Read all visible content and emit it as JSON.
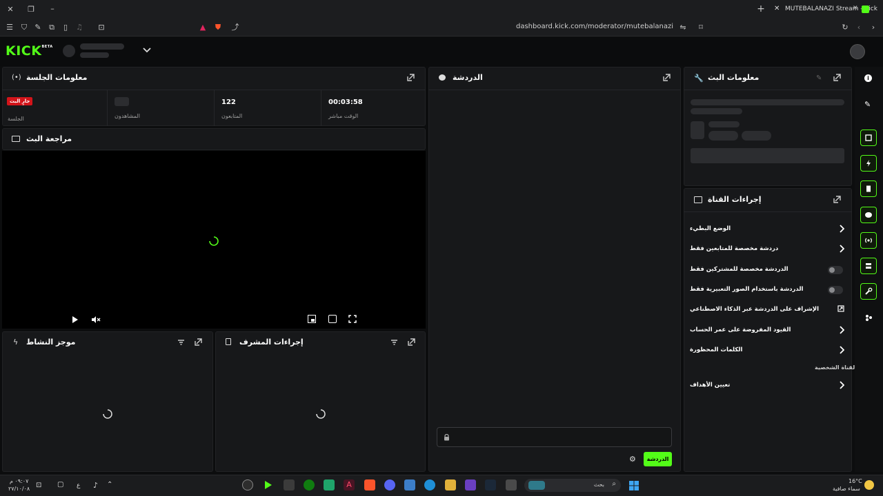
{
  "browser": {
    "tab_title": "MUTEBALANAZI Stream - Kick",
    "url": "dashboard.kick.com/moderator/mutebalanazi"
  },
  "brand": {
    "logo": "KICK",
    "beta": "BETA",
    "accent": "#53fc18"
  },
  "session": {
    "title": "معلومات الجلسة",
    "live_badge": "جارٍ البث",
    "session_label": "الجلسة",
    "viewers_label": "المشاهدون",
    "followers_value": "122",
    "followers_label": "المتابعون",
    "live_time_value": "00:03:58",
    "live_time_label": "الوقت مباشر"
  },
  "preview": {
    "title": "مراجعة البث"
  },
  "activity": {
    "title": "موجز النشاط"
  },
  "mod_actions": {
    "title": "إجراءات المشرف"
  },
  "chat": {
    "title": "الدردشة",
    "send_label": "الدردشة"
  },
  "stream_info": {
    "title": "معلومات البث"
  },
  "channel_actions": {
    "title": "إجراءات القناة",
    "items": [
      {
        "label": "الوضع البطيء",
        "control": "chevron"
      },
      {
        "label": "دردشة مخصصة للمتابعين فقط",
        "control": "chevron"
      },
      {
        "label": "الدردشة مخصصة للمشتركين فقط",
        "control": "toggle"
      },
      {
        "label": "الدردشة باستخدام الصور التعبيرية فقط",
        "control": "toggle"
      },
      {
        "label": "الإشراف على الدردشة عبر الذكاء الاصطناعي",
        "control": "external"
      },
      {
        "label": "القيود المفروضة على عمر الحساب",
        "control": "chevron"
      },
      {
        "label": "الكلمات المحظورة",
        "control": "chevron"
      }
    ],
    "section_label": "القناة الشخصية",
    "goals_label": "تعيين الأهداف"
  },
  "taskbar": {
    "time": "٠٩:٠٧ م",
    "date": "٢٧/١٠/٠٨",
    "lang": "ع",
    "search_placeholder": "بحث",
    "weather_temp": "16°C",
    "weather_desc": "سماء صافية"
  }
}
